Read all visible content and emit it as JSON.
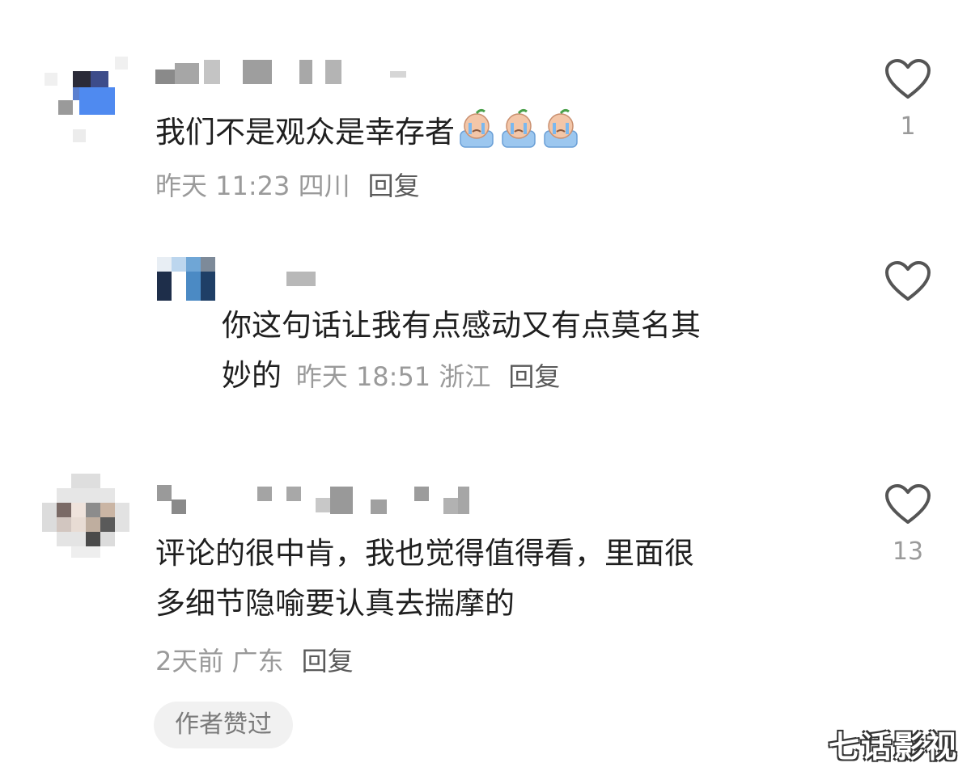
{
  "comments": [
    {
      "text": "我们不是观众是幸存者",
      "emoji": "crying-face-emoji",
      "time": "昨天 11:23",
      "location": "四川",
      "reply_label": "回复",
      "like_count": "1"
    },
    {
      "text_line1": "你这句话让我有点感动又有点莫名其",
      "text_line2": "妙的",
      "time": "昨天 18:51",
      "location": "浙江",
      "reply_label": "回复"
    },
    {
      "text_line1": "评论的很中肯，我也觉得值得看，里面很",
      "text_line2": "多细节隐喻要认真去揣摩的",
      "time": "2天前",
      "location": "广东",
      "reply_label": "回复",
      "like_count": "13",
      "badge": "作者赞过"
    }
  ],
  "watermark": "七话影视",
  "icons": {
    "like": "heart-outline-icon"
  },
  "colors": {
    "text": "#1f1f1f",
    "meta": "#9a9a9a",
    "reply": "#5a5a5a",
    "badge_bg": "#f1f1f1"
  }
}
